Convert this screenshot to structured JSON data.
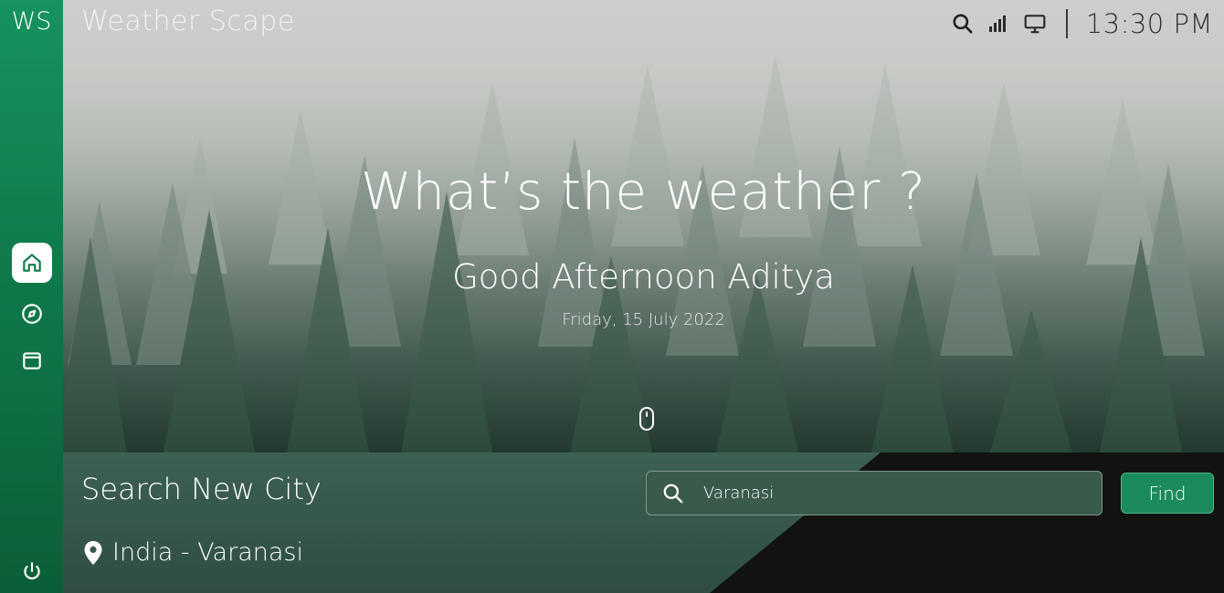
{
  "sidebar": {
    "logo": "WS",
    "items": [
      {
        "name": "home",
        "icon": "home-icon",
        "active": true
      },
      {
        "name": "explore",
        "icon": "compass-icon",
        "active": false
      },
      {
        "name": "calendar",
        "icon": "calendar-icon",
        "active": false
      }
    ],
    "power_icon": "power-icon"
  },
  "topbar": {
    "title": "Weather Scape",
    "icons": [
      "search-icon",
      "signal-icon",
      "monitor-icon"
    ],
    "time": "13:30 PM"
  },
  "hero": {
    "question": "What’s the weather ?",
    "greeting": "Good Afternoon Aditya",
    "date": "Friday, 15 July 2022",
    "scroll_icon": "mouse-scroll-icon"
  },
  "search": {
    "title": "Search New City",
    "input_value": "Varanasi",
    "button_label": "Find"
  },
  "location": {
    "text": "India - Varanasi",
    "icon": "map-pin-icon"
  },
  "colors": {
    "accent": "#1b8a5c",
    "sidebar_top": "#16935f",
    "panel_green": "#3c6152"
  }
}
